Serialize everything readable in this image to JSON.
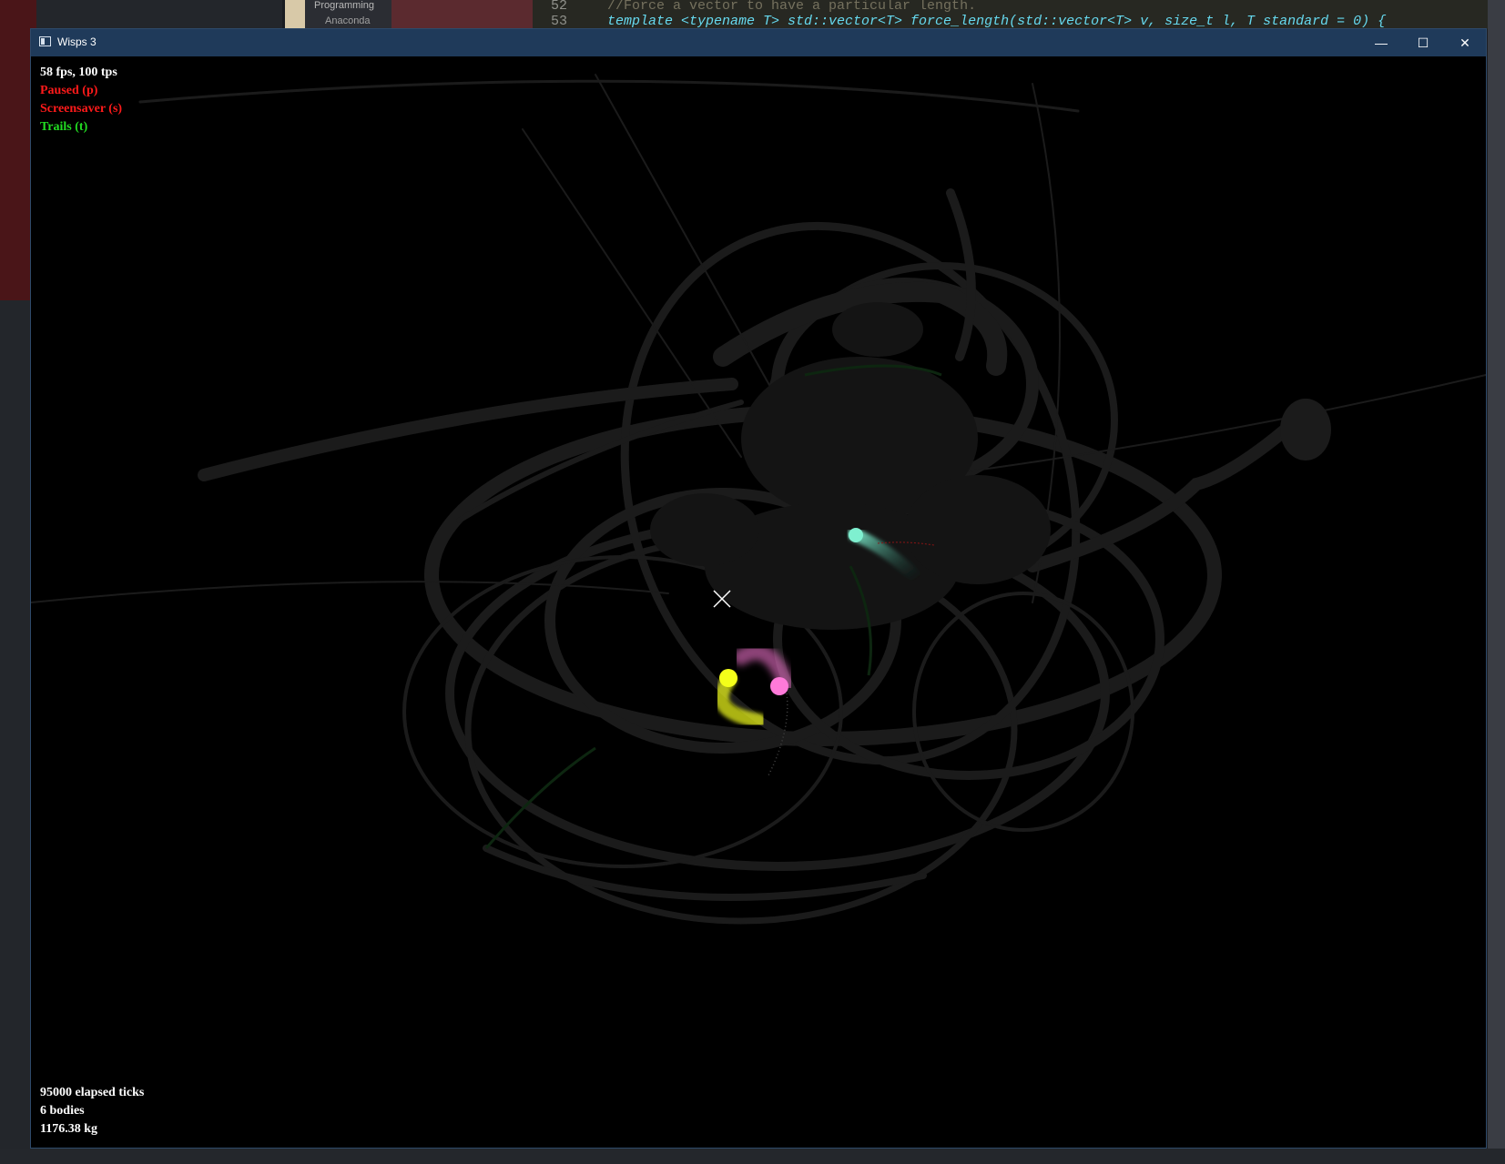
{
  "background": {
    "tree_programming": "Programming",
    "tree_anaconda": "Anaconda",
    "code_lines": [
      {
        "num": "52",
        "text": "//Force a vector to have a particular length."
      },
      {
        "num": "53",
        "text": "template <typename T> std::vector<T> force_length(std::vector<T> v, size_t l, T standard = 0) {"
      }
    ]
  },
  "window": {
    "title": "Wisps 3",
    "controls": {
      "minimize": "—",
      "maximize": "☐",
      "close": "✕"
    }
  },
  "hud": {
    "fps": "58 fps, 100 tps",
    "paused": "Paused (p)",
    "screensaver": "Screensaver (s)",
    "trails": "Trails (t)",
    "elapsed": "95000 elapsed ticks",
    "bodies": "6 bodies",
    "mass": "1176.38 kg"
  },
  "colors": {
    "paused": "#ff1a1a",
    "screensaver": "#ff1a1a",
    "trails": "#22dd22",
    "hud_text": "#ffffff",
    "body_cyan": "#7ff0d0",
    "body_pink": "#ff7ad9",
    "body_yellow": "#f4ff1a"
  }
}
